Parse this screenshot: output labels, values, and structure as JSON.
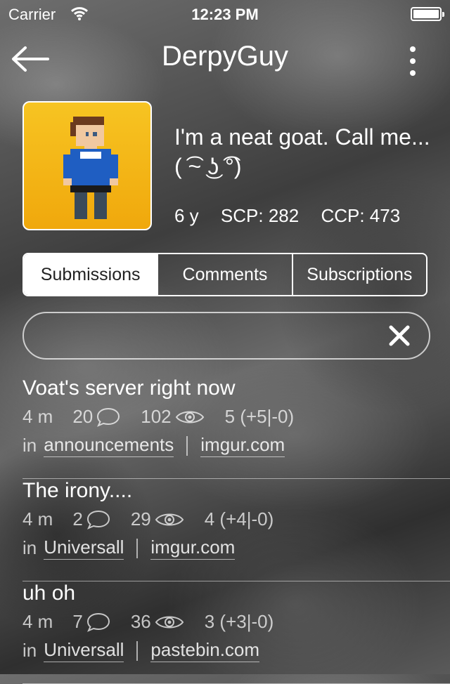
{
  "status_bar": {
    "carrier": "Carrier",
    "time": "12:23 PM"
  },
  "header": {
    "title": "DerpyGuy"
  },
  "profile": {
    "bio": "I'm a neat goat. Call me... ( ͡~ ͜ʖ ͡°)",
    "age": "6 y",
    "scp": "SCP: 282",
    "ccp": "CCP: 473"
  },
  "tabs": [
    {
      "label": "Submissions",
      "active": true
    },
    {
      "label": "Comments",
      "active": false
    },
    {
      "label": "Subscriptions",
      "active": false
    }
  ],
  "search": {
    "value": "",
    "placeholder": ""
  },
  "posts": [
    {
      "title": "Voat's server right now",
      "age": "4 m",
      "comments": "20",
      "views": "102",
      "score": "5 (+5|-0)",
      "in": "in",
      "subverse": "announcements",
      "domain": "imgur.com"
    },
    {
      "title": "The irony....",
      "age": "4 m",
      "comments": "2",
      "views": "29",
      "score": "4 (+4|-0)",
      "in": "in",
      "subverse": "Universall",
      "domain": "imgur.com"
    },
    {
      "title": "uh oh",
      "age": "4 m",
      "comments": "7",
      "views": "36",
      "score": "3 (+3|-0)",
      "in": "in",
      "subverse": "Universall",
      "domain": "pastebin.com"
    }
  ],
  "icons": {
    "back": "back-arrow-icon",
    "more": "more-vertical-icon",
    "clear": "close-icon",
    "comment": "comment-bubble-icon",
    "views": "eye-icon",
    "wifi": "wifi-icon",
    "battery": "battery-icon"
  },
  "colors": {
    "avatar_bg": "#f5b818",
    "active_tab_bg": "#ffffff",
    "active_tab_text": "#222222"
  }
}
